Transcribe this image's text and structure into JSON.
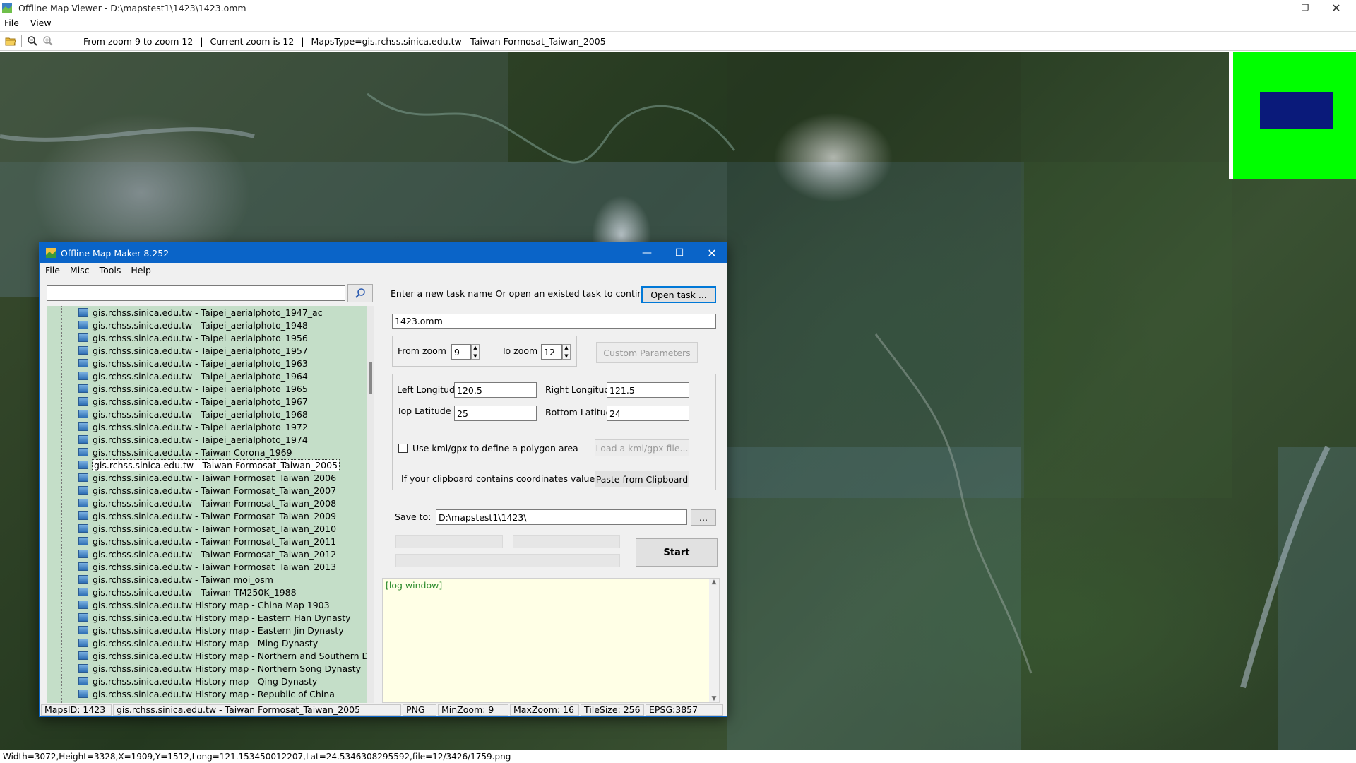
{
  "window": {
    "title": "Offline Map Viewer - D:\\mapstest1\\1423\\1423.omm"
  },
  "menu": {
    "file": "File",
    "view": "View"
  },
  "toolbar": {
    "zoom_range": "From zoom 9 to zoom 12",
    "sep1": "|",
    "current_zoom": "Current zoom is 12",
    "sep2": "|",
    "maps_type": "MapsType=gis.rchss.sinica.edu.tw - Taiwan Formosat_Taiwan_2005"
  },
  "statusbar": {
    "text": "Width=3072,Height=3328,X=1909,Y=1512,Long=121.153450012207,Lat=24.5346308295592,file=12/3426/1759.png"
  },
  "dialog": {
    "title": "Offline Map Maker 8.252",
    "menu": [
      "File",
      "Misc",
      "Tools",
      "Help"
    ],
    "search_value": "",
    "tree_items": [
      "gis.rchss.sinica.edu.tw - Taipei_aerialphoto_1947_ac",
      "gis.rchss.sinica.edu.tw - Taipei_aerialphoto_1948",
      "gis.rchss.sinica.edu.tw - Taipei_aerialphoto_1956",
      "gis.rchss.sinica.edu.tw - Taipei_aerialphoto_1957",
      "gis.rchss.sinica.edu.tw - Taipei_aerialphoto_1963",
      "gis.rchss.sinica.edu.tw - Taipei_aerialphoto_1964",
      "gis.rchss.sinica.edu.tw - Taipei_aerialphoto_1965",
      "gis.rchss.sinica.edu.tw - Taipei_aerialphoto_1967",
      "gis.rchss.sinica.edu.tw - Taipei_aerialphoto_1968",
      "gis.rchss.sinica.edu.tw - Taipei_aerialphoto_1972",
      "gis.rchss.sinica.edu.tw - Taipei_aerialphoto_1974",
      "gis.rchss.sinica.edu.tw - Taiwan Corona_1969",
      "gis.rchss.sinica.edu.tw - Taiwan Formosat_Taiwan_2005",
      "gis.rchss.sinica.edu.tw - Taiwan Formosat_Taiwan_2006",
      "gis.rchss.sinica.edu.tw - Taiwan Formosat_Taiwan_2007",
      "gis.rchss.sinica.edu.tw - Taiwan Formosat_Taiwan_2008",
      "gis.rchss.sinica.edu.tw - Taiwan Formosat_Taiwan_2009",
      "gis.rchss.sinica.edu.tw - Taiwan Formosat_Taiwan_2010",
      "gis.rchss.sinica.edu.tw - Taiwan Formosat_Taiwan_2011",
      "gis.rchss.sinica.edu.tw - Taiwan Formosat_Taiwan_2012",
      "gis.rchss.sinica.edu.tw - Taiwan Formosat_Taiwan_2013",
      "gis.rchss.sinica.edu.tw - Taiwan moi_osm",
      "gis.rchss.sinica.edu.tw - Taiwan TM250K_1988",
      "gis.rchss.sinica.edu.tw History map - China Map 1903",
      "gis.rchss.sinica.edu.tw History map - Eastern Han Dynasty",
      "gis.rchss.sinica.edu.tw History map - Eastern Jin Dynasty",
      "gis.rchss.sinica.edu.tw History map - Ming Dynasty",
      "gis.rchss.sinica.edu.tw History map - Northern and Southern Dynasty",
      "gis.rchss.sinica.edu.tw History map - Northern Song Dynasty",
      "gis.rchss.sinica.edu.tw History map - Qing Dynasty",
      "gis.rchss.sinica.edu.tw History map - Republic of China"
    ],
    "selected_tree_item": "gis.rchss.sinica.edu.tw - Taiwan Formosat_Taiwan_2005",
    "task_prompt": "Enter a new task name Or open an existed task to continue:",
    "open_task": "Open task ...",
    "task_name": "1423.omm",
    "from_zoom_label": "From zoom",
    "from_zoom": "9",
    "to_zoom_label": "To zoom",
    "to_zoom": "12",
    "custom_params": "Custom Parameters",
    "left_lon_label": "Left Longitude",
    "left_lon": "120.5",
    "right_lon_label": "Right Longitude",
    "right_lon": "121.5",
    "top_lat_label": "Top Latitude",
    "top_lat": "25",
    "bottom_lat_label": "Bottom Latitude",
    "bottom_lat": "24",
    "kml_label": "Use kml/gpx to define a polygon area",
    "kml_checked": false,
    "load_kml": "Load a kml/gpx file...",
    "clipboard_label": "If your clipboard contains coordinates values:",
    "paste": "Paste from Clipboard",
    "save_label": "Save to:",
    "save_path": "D:\\mapstest1\\1423\\",
    "browse": "...",
    "start": "Start",
    "log": "[log window]",
    "status": {
      "maps_id": "MapsID: 1423",
      "map_name": "gis.rchss.sinica.edu.tw - Taiwan Formosat_Taiwan_2005",
      "format": "PNG",
      "min_zoom": "MinZoom: 9",
      "max_zoom": "MaxZoom: 16",
      "tile_size": "TileSize: 256",
      "epsg": "EPSG:3857"
    }
  },
  "colors": {
    "accent": "#0a64c8",
    "tree_bg": "#c4dec8",
    "minimap": "#00ff00",
    "minimap_view": "#0a1a7a",
    "log_bg": "#ffffe6",
    "log_text": "#2a8a2a"
  }
}
